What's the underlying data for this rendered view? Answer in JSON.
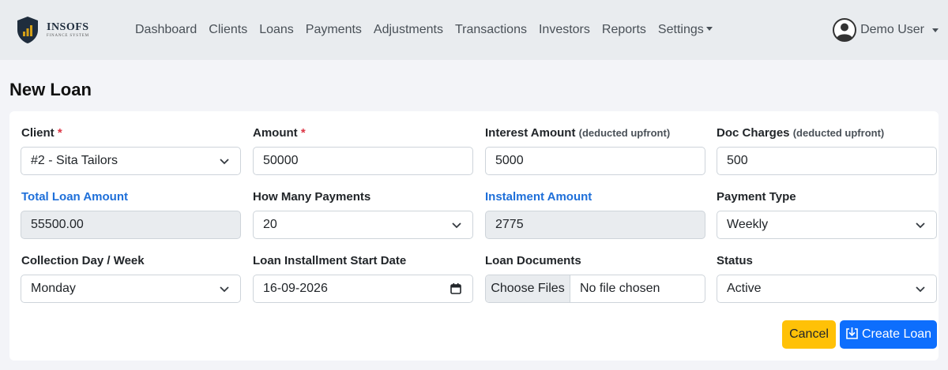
{
  "brand": {
    "name": "INSOFS",
    "tagline": "FINANCE SYSTEM"
  },
  "nav": {
    "items": [
      "Dashboard",
      "Clients",
      "Loans",
      "Payments",
      "Adjustments",
      "Transactions",
      "Investors",
      "Reports",
      "Settings"
    ]
  },
  "user": {
    "name": "Demo User"
  },
  "page": {
    "title": "New Loan"
  },
  "form": {
    "client": {
      "label": "Client",
      "value": "#2 - Sita Tailors"
    },
    "amount": {
      "label": "Amount",
      "value": "50000"
    },
    "interest": {
      "label": "Interest Amount",
      "hint": "(deducted upfront)",
      "value": "5000"
    },
    "doc": {
      "label": "Doc Charges",
      "hint": "(deducted upfront)",
      "value": "500"
    },
    "total": {
      "label": "Total Loan Amount",
      "value": "55500.00"
    },
    "payments": {
      "label": "How Many Payments",
      "value": "20"
    },
    "instalment": {
      "label": "Instalment Amount",
      "value": "2775"
    },
    "ptype": {
      "label": "Payment Type",
      "value": "Weekly"
    },
    "cday": {
      "label": "Collection Day / Week",
      "value": "Monday"
    },
    "start": {
      "label": "Loan Installment Start Date",
      "value": "16-09-2026"
    },
    "docs": {
      "label": "Loan Documents",
      "button": "Choose Files",
      "status": "No file chosen"
    },
    "status": {
      "label": "Status",
      "value": "Active"
    }
  },
  "actions": {
    "cancel": "Cancel",
    "create": "Create Loan"
  },
  "colors": {
    "primary": "#0d6efd",
    "warning": "#ffc107",
    "required": "#dc3545",
    "computed_label": "#1e6fd9"
  }
}
